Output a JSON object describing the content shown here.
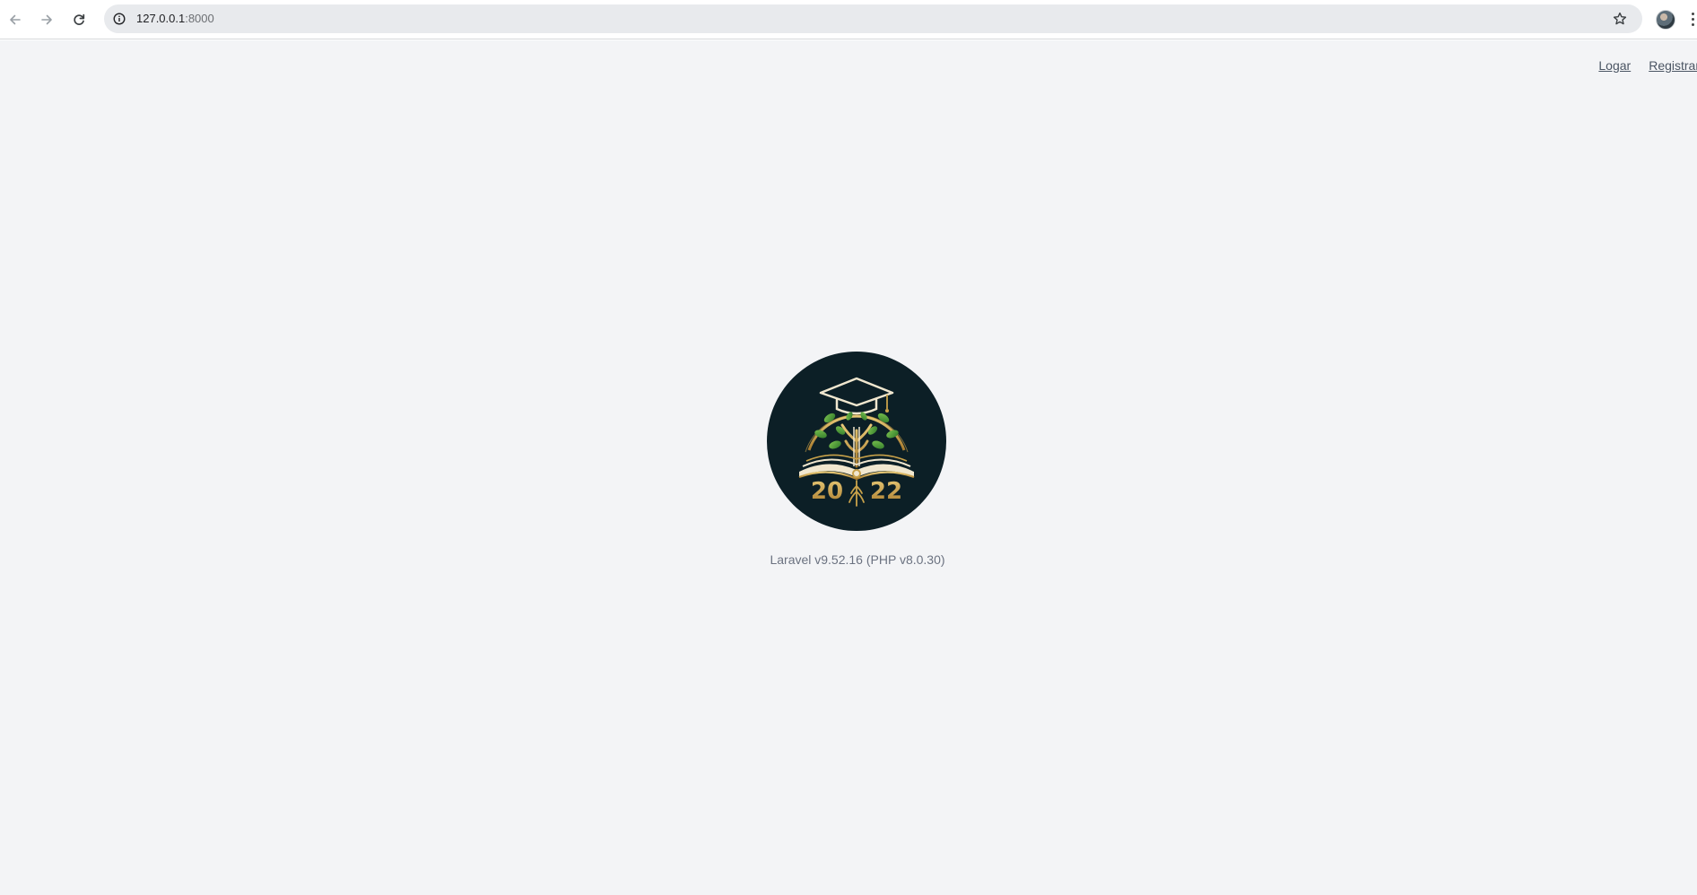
{
  "browser": {
    "back_icon": "arrow-left-icon",
    "forward_icon": "arrow-right-icon",
    "reload_icon": "reload-icon",
    "site_info_icon": "info-circle-icon",
    "url_host": "127.0.0.1",
    "url_port": ":8000",
    "bookmark_icon": "star-outline-icon",
    "profile_icon": "avatar",
    "menu_icon": "kebab-menu-icon"
  },
  "header": {
    "login_label": "Logar",
    "register_label": "Registrar"
  },
  "logo": {
    "year": "2022",
    "colors": {
      "background": "#0c1f26",
      "gold": "#c9a24a",
      "green": "#4f9a3a",
      "cream": "#f1e7cf"
    }
  },
  "footer": {
    "version_text": "Laravel v9.52.16 (PHP v8.0.30)"
  },
  "theme": {
    "page_background": "#f3f4f6",
    "link_color": "#4b5563",
    "muted_text": "#6b7280"
  }
}
